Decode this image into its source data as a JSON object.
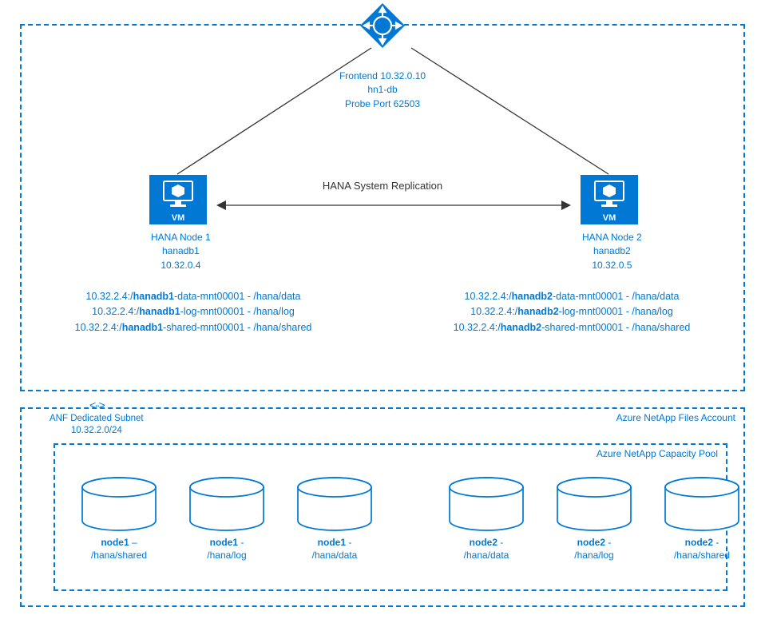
{
  "load_balancer": {
    "frontend": "Frontend 10.32.0.10",
    "name": "hn1-db",
    "probe": "Probe Port 62503"
  },
  "hsr_label": "HANA System Replication",
  "vm_label": "VM",
  "node1": {
    "title": "HANA Node 1",
    "host": "hanadb1",
    "ip": "10.32.0.4",
    "mount_prefix": "10.32.2.4:/",
    "mount_bold": "hanadb1",
    "mounts": [
      {
        "suffix": "-data-mnt00001 - /hana/data"
      },
      {
        "suffix": "-log-mnt00001 - /hana/log"
      },
      {
        "suffix": "-shared-mnt00001 - /hana/shared"
      }
    ]
  },
  "node2": {
    "title": "HANA Node 2",
    "host": "hanadb2",
    "ip": "10.32.0.5",
    "mount_prefix": "10.32.2.4:/",
    "mount_bold": "hanadb2",
    "mounts": [
      {
        "suffix": "-data-mnt00001 - /hana/data"
      },
      {
        "suffix": "-log-mnt00001 - /hana/log"
      },
      {
        "suffix": "-shared-mnt00001 - /hana/shared"
      }
    ]
  },
  "anf": {
    "subnet_label": "ANF Dedicated Subnet",
    "subnet_cidr": "10.32.2.0/24",
    "account_label": "Azure NetApp Files Account",
    "pool_label": "Azure NetApp Capacity Pool",
    "disks": [
      {
        "bold": "node1",
        "sep": " –",
        "path": "/hana/shared"
      },
      {
        "bold": "node1",
        "sep": " -",
        "path": "/hana/log"
      },
      {
        "bold": "node1",
        "sep": " -",
        "path": "/hana/data"
      },
      {
        "bold": "node2",
        "sep": " -",
        "path": "/hana/data"
      },
      {
        "bold": "node2",
        "sep": " -",
        "path": "/hana/log"
      },
      {
        "bold": "node2",
        "sep": " -",
        "path": "/hana/shared"
      }
    ]
  }
}
